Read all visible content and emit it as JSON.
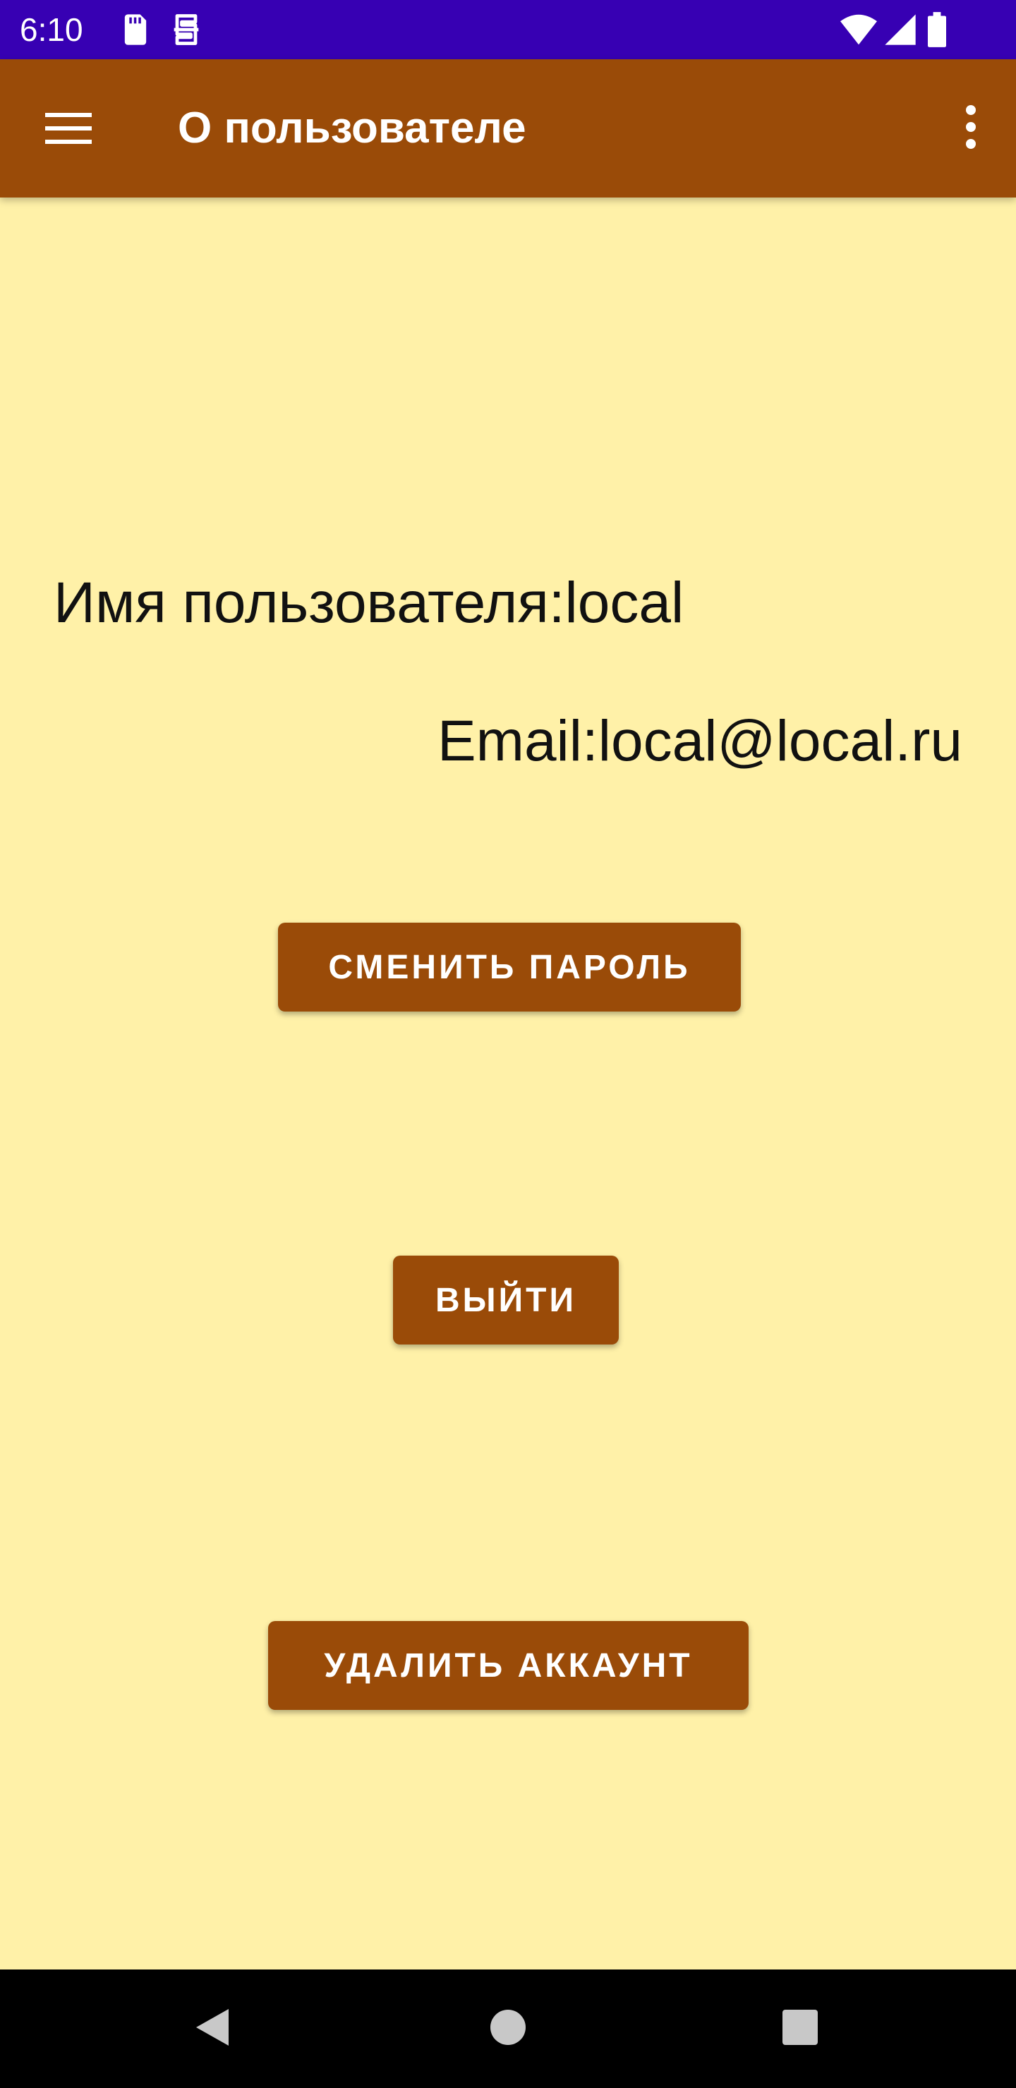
{
  "status_bar": {
    "time": "6:10",
    "background": "#3700b3",
    "icons": [
      "sd-card-icon",
      "sync-icon",
      "wifi-icon",
      "signal-icon",
      "battery-icon"
    ]
  },
  "app_bar": {
    "title": "О пользователе",
    "background": "#9a4b08",
    "menu_icon": "hamburger-menu-icon",
    "overflow_icon": "more-vert-icon"
  },
  "profile": {
    "username_line": "Имя пользователя:local",
    "email_line": "Email:local@local.ru"
  },
  "buttons": {
    "change_password": "СМЕНИТЬ ПАРОЛЬ",
    "logout": "ВЫЙТИ",
    "delete_account": "УДАЛИТЬ АККАУНТ"
  },
  "colors": {
    "screen_background": "#fff1a8",
    "accent": "#9a4b08",
    "text": "#111111"
  },
  "nav_bar": {
    "icons": [
      "back-icon",
      "home-icon",
      "recents-icon"
    ]
  }
}
